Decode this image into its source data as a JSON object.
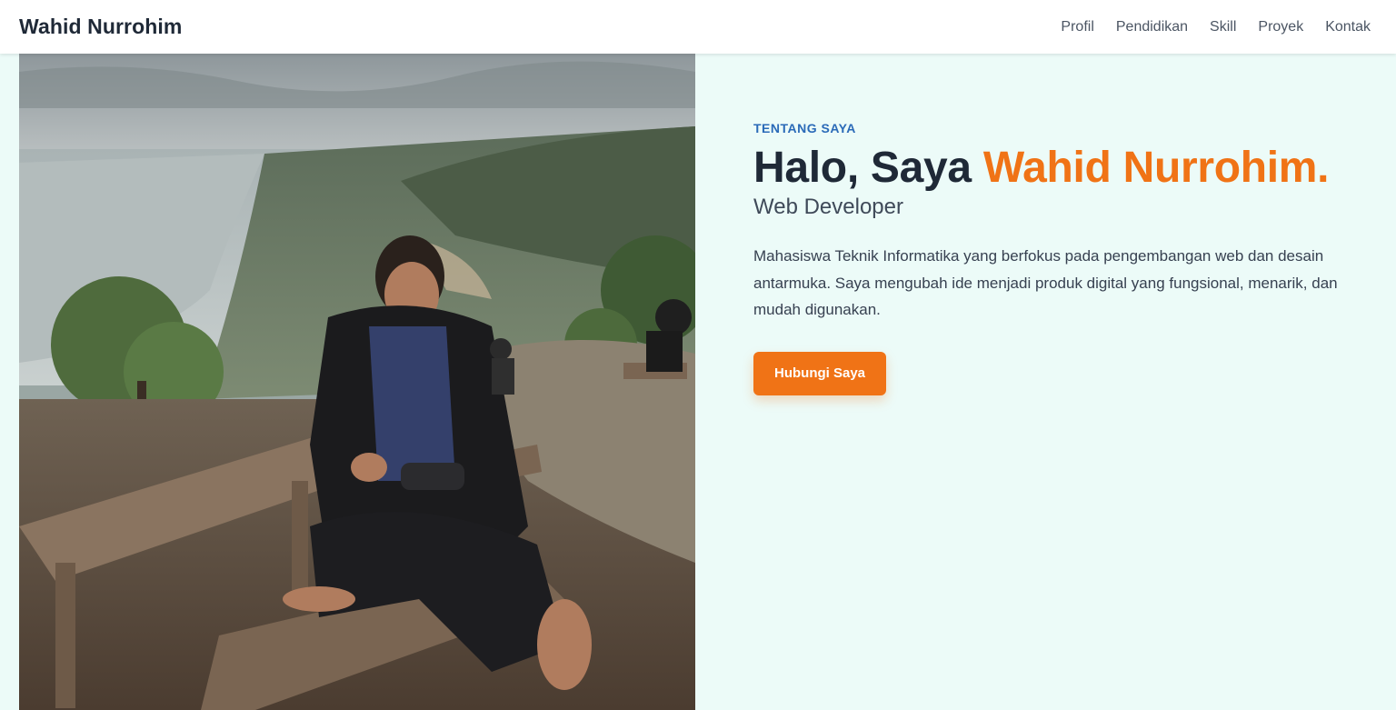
{
  "nav": {
    "brand": "Wahid Nurrohim",
    "links": [
      "Profil",
      "Pendidikan",
      "Skill",
      "Proyek",
      "Kontak"
    ]
  },
  "hero": {
    "eyebrow": "TENTANG SAYA",
    "greeting": "Halo, Saya",
    "name": "Wahid Nurrohim.",
    "role": "Web Developer",
    "bio": "Mahasiswa Teknik Informatika yang berfokus pada pengembangan web dan desain antarmuka. Saya mengubah ide menjadi produk digital yang fungsional, menarik, dan mudah digunakan.",
    "cta_label": "Hubungi Saya"
  },
  "colors": {
    "accent": "#f07316",
    "eyebrow": "#2a6ab8",
    "background": "#ecfbf8"
  }
}
